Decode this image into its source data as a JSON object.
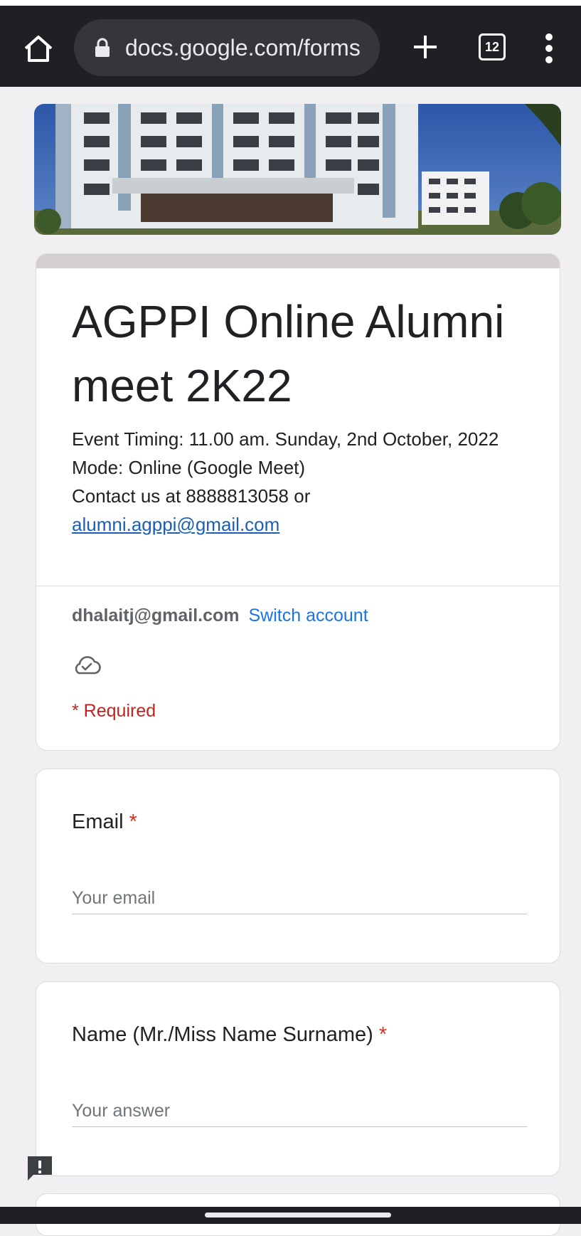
{
  "browser": {
    "url": "docs.google.com/forms",
    "tab_count": "12"
  },
  "form": {
    "title": "AGPPI Online Alumni meet 2K22",
    "description_line1": "Event Timing: 11.00 am. Sunday, 2nd October, 2022",
    "description_line2": "Mode: Online (Google Meet)",
    "description_line3": "Contact us at 8888813058 or",
    "contact_email": "alumni.agppi@gmail.com",
    "account_email": "dhalaitj@gmail.com",
    "switch_account_label": "Switch account",
    "required_note": "* Required"
  },
  "questions": [
    {
      "label": "Email",
      "required_mark": "*",
      "placeholder": "Your email"
    },
    {
      "label": "Name (Mr./Miss Name Surname)",
      "required_mark": "*",
      "placeholder": "Your answer"
    }
  ],
  "colors": {
    "toolbar": "#1f2024",
    "page_background": "#f1eff2",
    "title_accent": "#d5cfcf",
    "link": "#1a73e8",
    "required": "#d93025"
  }
}
